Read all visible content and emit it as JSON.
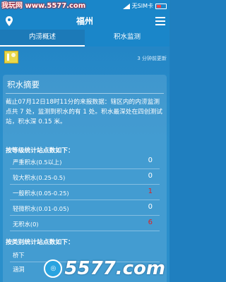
{
  "statusbar": {
    "watermark": "我玩网 www.5577.com",
    "sim": "无SIM卡"
  },
  "appbar": {
    "title": "福州"
  },
  "tabs": [
    {
      "label": "内涝概述",
      "active": true
    },
    {
      "label": "积水监测",
      "active": false
    }
  ],
  "content": {
    "update_time": "3 分钟前更新",
    "panel_title": "积水摘要",
    "summary": "截止07月12日18时11分的来报数据：辖区内的内涝监测点共 7 处，监测到积水的有 1 处。积水最深处在四创测试站，积水深 0.15 米。",
    "section1_title": "按等级统计站点数如下：",
    "levels": [
      {
        "label": "严重积水(0.5以上)",
        "value": "0",
        "color": "#ffffff"
      },
      {
        "label": "较大积水(0.25-0.5)",
        "value": "0",
        "color": "#ffffff"
      },
      {
        "label": "一般积水(0.05-0.25)",
        "value": "1",
        "color": "#e02020"
      },
      {
        "label": "轻微积水(0.01-0.05)",
        "value": "0",
        "color": "#ffffff"
      },
      {
        "label": "无积水(0)",
        "value": "6",
        "color": "#e02020"
      }
    ],
    "section2_title": "按类别统计站点数如下：",
    "categories": [
      {
        "label": "桥下",
        "value": ""
      },
      {
        "label": "涵洞",
        "value": ""
      }
    ],
    "logo_text": "5577.com"
  }
}
